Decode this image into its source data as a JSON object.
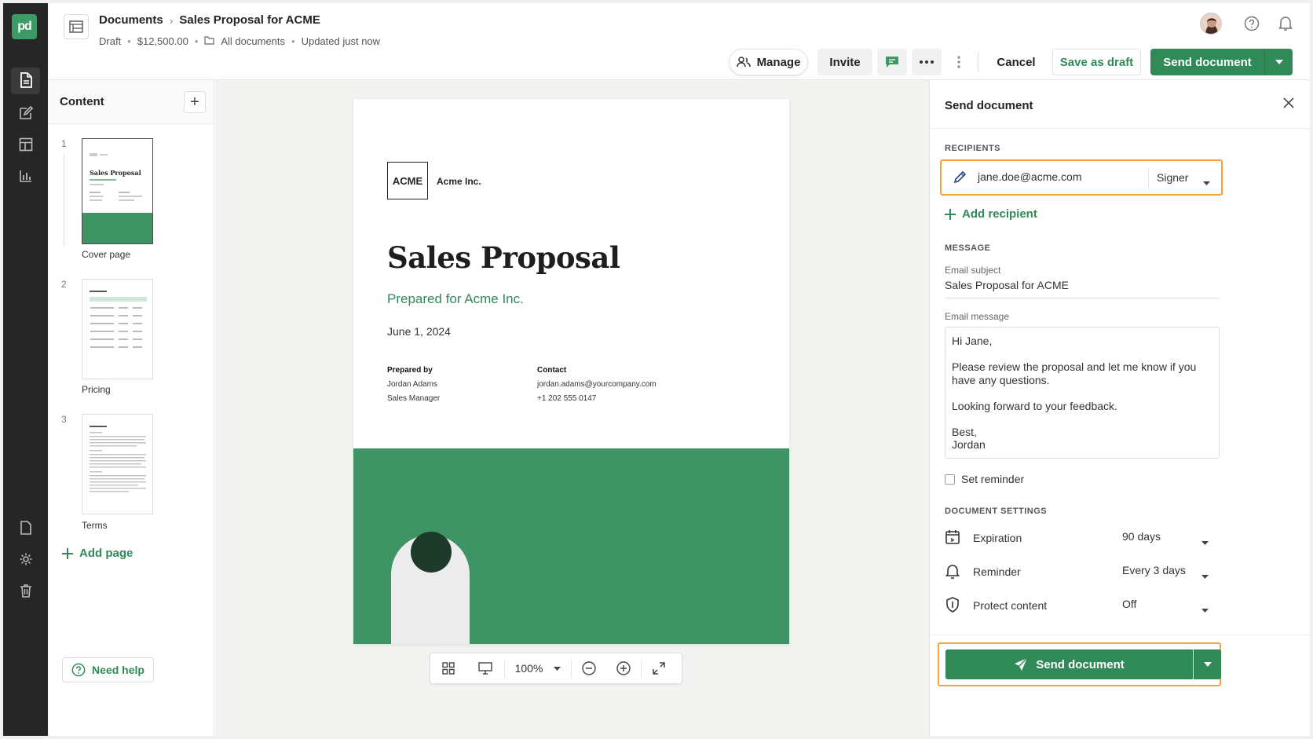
{
  "brand": {
    "logo_text": "pd",
    "accent": "#2f8a57"
  },
  "header": {
    "breadcrumb_root": "Documents",
    "breadcrumb_doc": "Sales Proposal for ACME",
    "status": "Draft",
    "amount": "$12,500.00",
    "folder": "All documents",
    "updated": "Updated just now",
    "manage_label": "Manage",
    "invite_label": "Invite",
    "cancel_label": "Cancel",
    "save_draft_label": "Save as draft",
    "send_label": "Send document"
  },
  "content_panel": {
    "title": "Content",
    "pages": [
      {
        "num": "1",
        "label": "Cover page"
      },
      {
        "num": "2",
        "label": "Pricing"
      },
      {
        "num": "3",
        "label": "Terms"
      }
    ],
    "add_page_label": "Add page",
    "help_label": "Need help"
  },
  "document": {
    "logo": "ACME",
    "company": "Acme Inc.",
    "title": "Sales Proposal",
    "subtitle": "Prepared for Acme Inc.",
    "date": "June 1, 2024",
    "prepared_by_label": "Prepared by",
    "prepared_by_name": "Jordan Adams",
    "prepared_by_role": "Sales Manager",
    "contact_label": "Contact",
    "contact_email": "jordan.adams@yourcompany.com",
    "contact_phone": "+1 202 555 0147"
  },
  "zoom": {
    "level": "100%"
  },
  "send_panel": {
    "title": "Send document",
    "recipients_label": "RECIPIENTS",
    "recipient_email": "jane.doe@acme.com",
    "recipient_role": "Signer",
    "add_recipient_label": "Add recipient",
    "message_label": "MESSAGE",
    "subject_label": "Email subject",
    "subject_value": "Sales Proposal for ACME",
    "message_field_label": "Email message",
    "message_value": "Hi Jane,\n\nPlease review the proposal and let me know if you have any questions.\n\nLooking forward to your feedback.\n\nBest,\nJordan",
    "set_reminder_label": "Set reminder",
    "settings_label": "DOCUMENT SETTINGS",
    "settings": [
      {
        "name": "Expiration",
        "value": "90 days"
      },
      {
        "name": "Reminder",
        "value": "Every 3 days"
      },
      {
        "name": "Protect content",
        "value": "Off"
      }
    ],
    "send_label": "Send document"
  }
}
